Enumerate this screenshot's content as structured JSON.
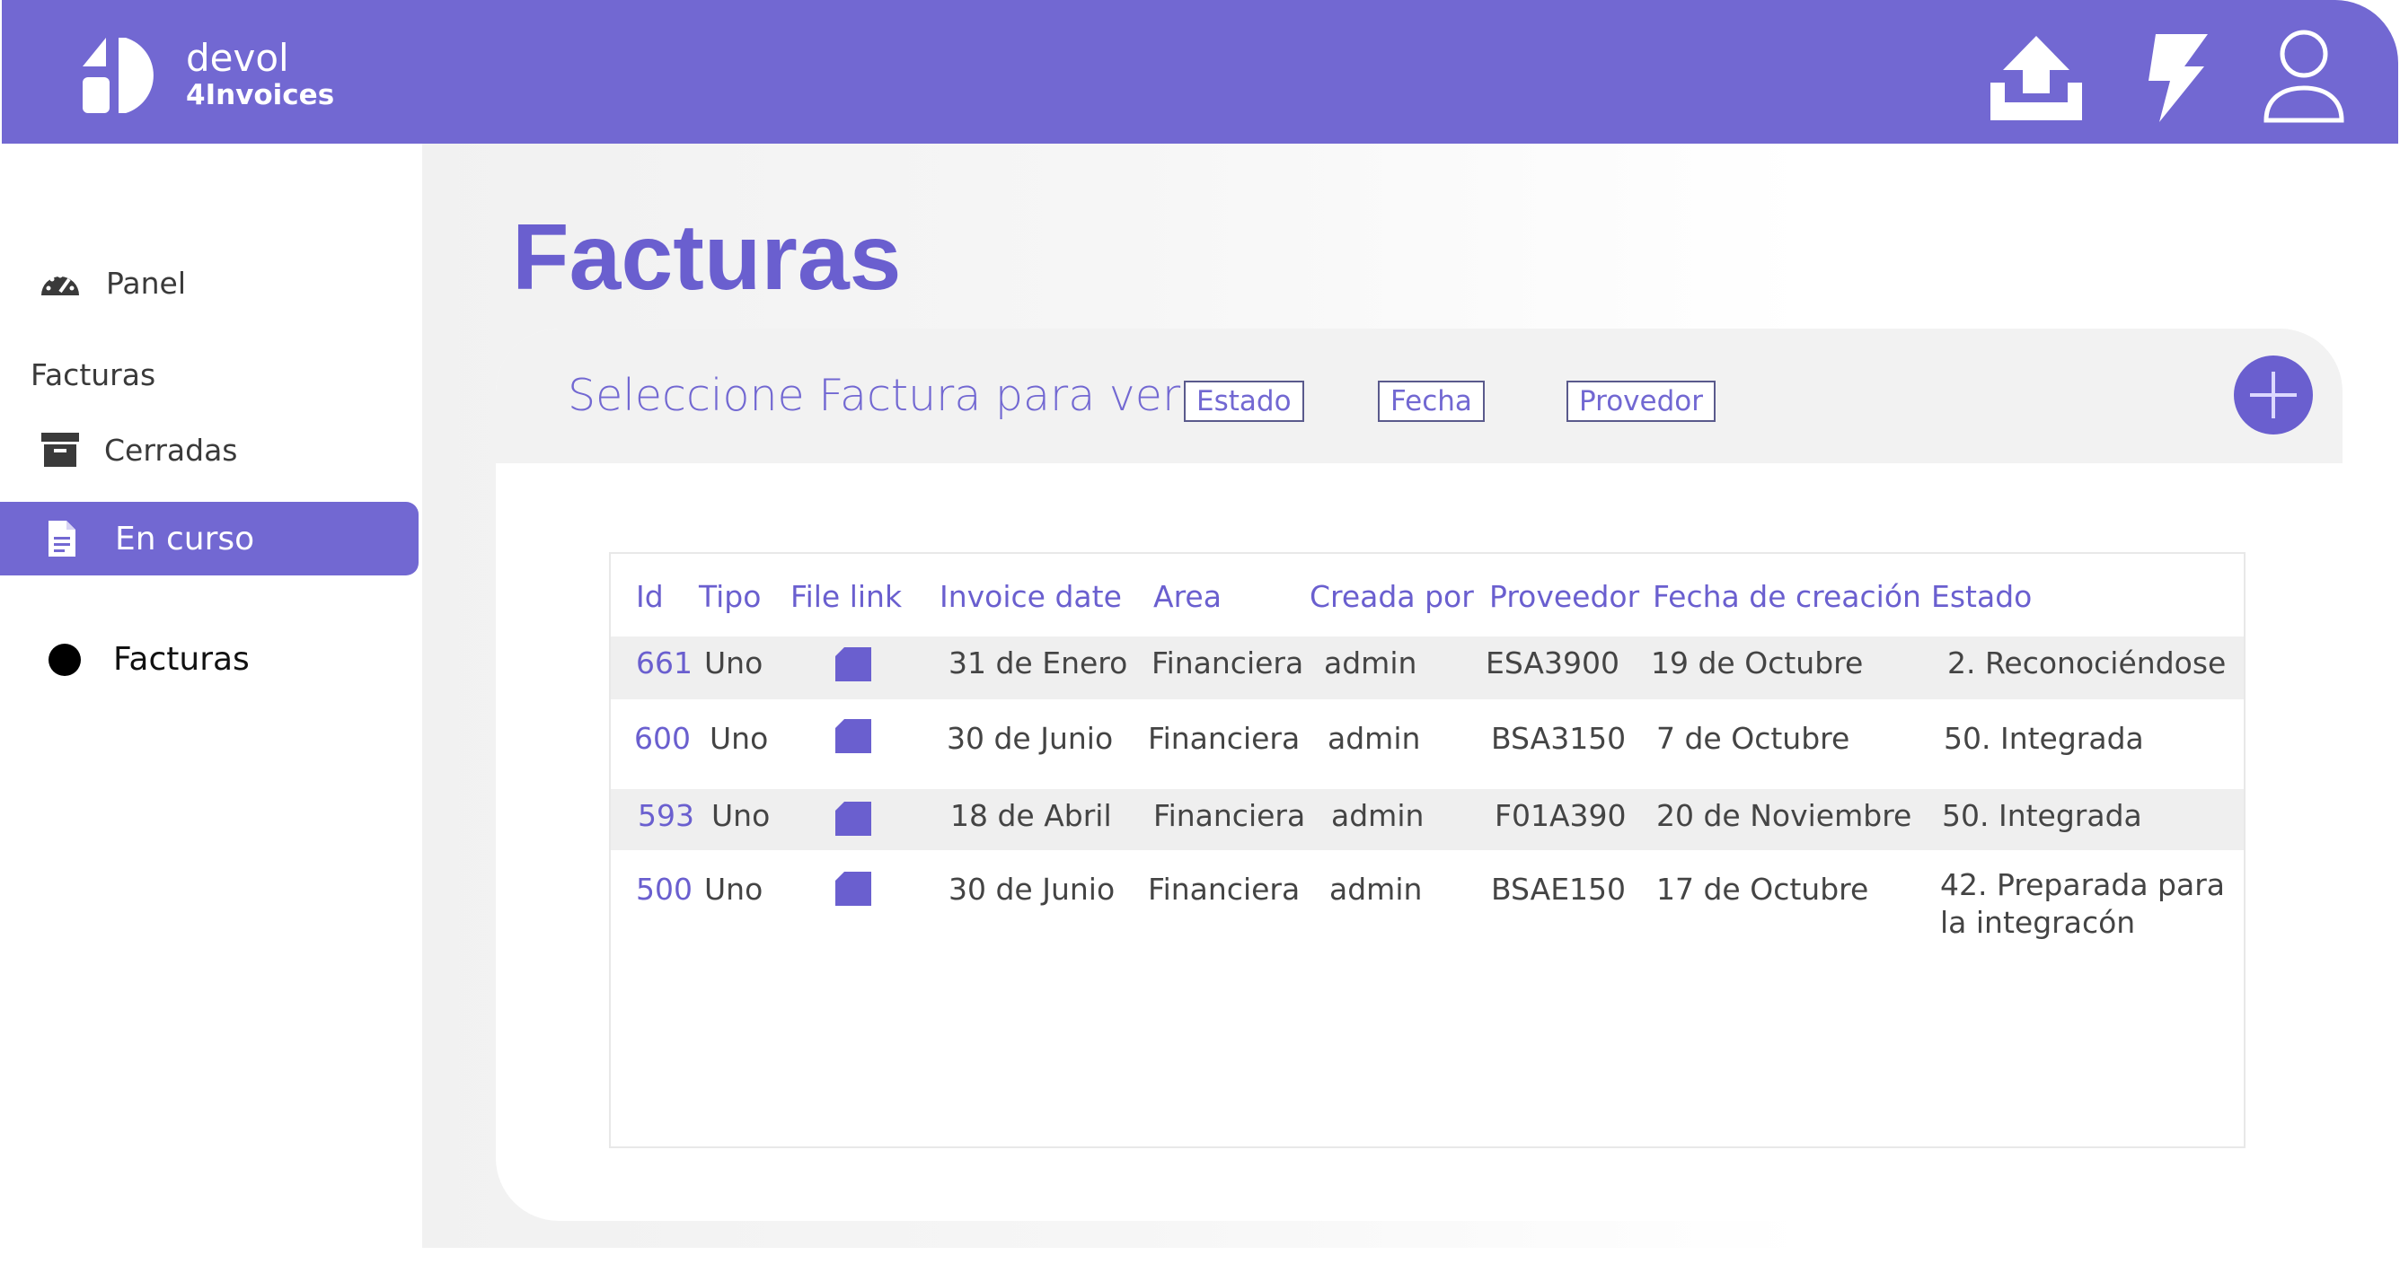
{
  "app": {
    "brand_line1": "devol",
    "brand_line2": "4Invoices",
    "accent_color": "#7268d2"
  },
  "topbar": {
    "icons": [
      "upload-icon",
      "lightning-icon",
      "user-icon"
    ]
  },
  "sidebar": {
    "items": [
      {
        "label": "Panel",
        "icon": "dashboard-gauge-icon"
      },
      {
        "label": "Facturas",
        "icon": ""
      },
      {
        "label": "Cerradas",
        "icon": "archive-box-icon"
      },
      {
        "label": "En curso",
        "icon": "document-icon",
        "active": true
      },
      {
        "label": "Facturas",
        "icon": "black-dot-icon"
      }
    ]
  },
  "main": {
    "title": "Facturas",
    "card_title": "Seleccione Factura para ver",
    "filters": [
      "Estado",
      "Fecha",
      "Provedor"
    ],
    "add_button_icon": "plus-icon"
  },
  "table": {
    "columns": [
      "Id",
      "Tipo",
      "File link",
      "Invoice date",
      "Area",
      "Creada por",
      "Proveedor",
      "Fecha de creación",
      "Estado"
    ],
    "rows": [
      {
        "id": "661",
        "tipo": "Uno",
        "invoice_date": "31 de Enero",
        "area": "Financiera",
        "creada_por": "admin",
        "proveedor": "ESA3900",
        "fecha_creacion": "19 de Octubre",
        "estado": "2. Reconociéndose"
      },
      {
        "id": "600",
        "tipo": "Uno",
        "invoice_date": "30 de Junio",
        "area": "Financiera",
        "creada_por": "admin",
        "proveedor": "BSA3150",
        "fecha_creacion": "7 de Octubre",
        "estado": "50. Integrada"
      },
      {
        "id": "593",
        "tipo": "Uno",
        "invoice_date": "18 de Abril",
        "area": "Financiera",
        "creada_por": "admin",
        "proveedor": "F01A390",
        "fecha_creacion": "20 de Noviembre",
        "estado": "50. Integrada"
      },
      {
        "id": "500",
        "tipo": "Uno",
        "invoice_date": "30 de Junio",
        "area": "Financiera",
        "creada_por": "admin",
        "proveedor": "BSAE150",
        "fecha_creacion": "17 de Octubre",
        "estado": "42. Preparada para la integracón"
      }
    ]
  }
}
